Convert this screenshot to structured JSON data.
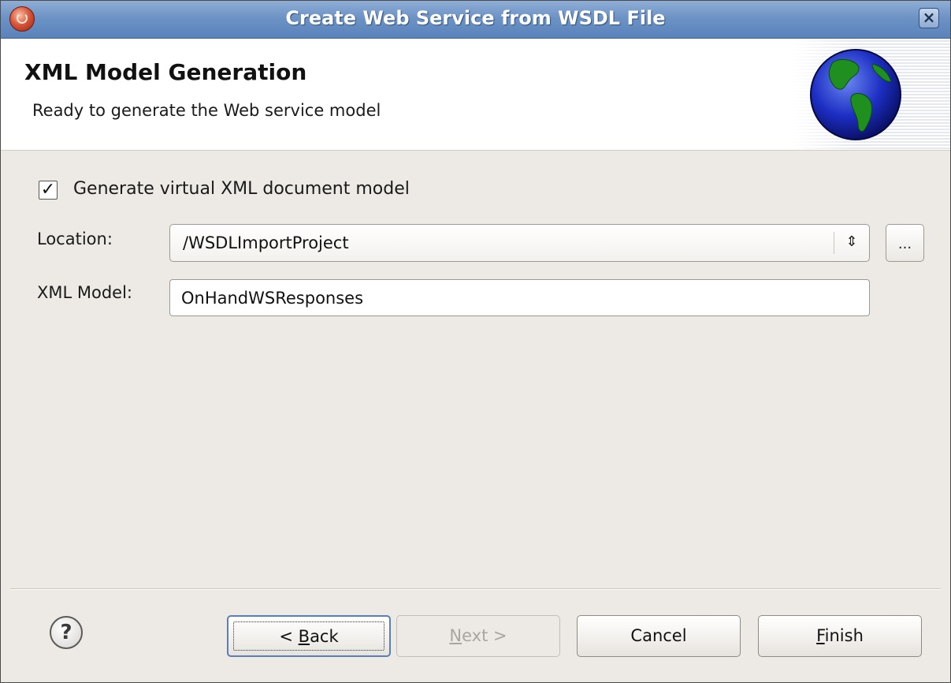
{
  "window": {
    "title": "Create Web Service from WSDL File"
  },
  "header": {
    "title": "XML Model Generation",
    "description": "Ready to generate the Web service model"
  },
  "form": {
    "generate_checkbox": {
      "label": "Generate virtual XML document model",
      "checked": true
    },
    "location": {
      "label": "Location:",
      "value": "/WSDLImportProject",
      "browse_label": "..."
    },
    "xml_model": {
      "label": "XML Model:",
      "value": "OnHandWSResponses"
    }
  },
  "buttons": {
    "back": {
      "prefix": "< ",
      "mnemonic": "B",
      "rest": "ack"
    },
    "next": {
      "mnemonic": "N",
      "rest": "ext >",
      "enabled": false
    },
    "cancel": "Cancel",
    "finish": {
      "mnemonic": "F",
      "rest": "inish"
    }
  },
  "icons": {
    "app": "eclipse-app-icon",
    "close": "close-icon",
    "globe": "globe-icon",
    "help": "help-icon",
    "combo_arrow": "up-down-arrow-icon"
  },
  "colors": {
    "titlebar": "#6d93c5",
    "dialog_bg": "#edeae6",
    "banner_bg": "#ffffff"
  }
}
